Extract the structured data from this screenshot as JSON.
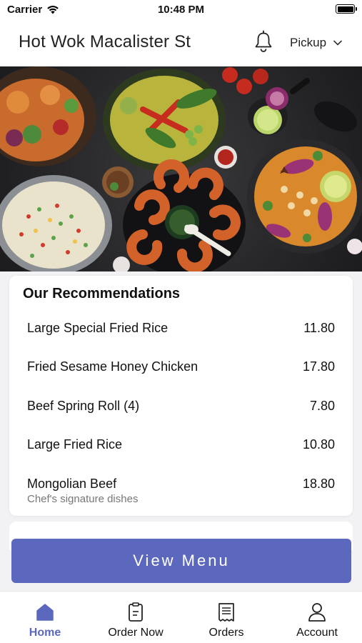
{
  "status_bar": {
    "carrier": "Carrier",
    "time": "10:48 PM"
  },
  "header": {
    "title": "Hot Wok Macalister St",
    "order_mode": "Pickup"
  },
  "recommendations": {
    "title": "Our Recommendations",
    "items": [
      {
        "name": "Large Special Fried Rice",
        "price": "11.80",
        "note": ""
      },
      {
        "name": "Fried Sesame Honey Chicken",
        "price": "17.80",
        "note": ""
      },
      {
        "name": "Beef Spring Roll (4)",
        "price": "7.80",
        "note": ""
      },
      {
        "name": "Large Fried Rice",
        "price": "10.80",
        "note": ""
      },
      {
        "name": "Mongolian Beef",
        "price": "18.80",
        "note": "Chef's signature dishes"
      }
    ]
  },
  "view_menu": {
    "label": "View Menu"
  },
  "tab_bar": {
    "tabs": [
      {
        "label": "Home",
        "icon": "home-icon",
        "active": true
      },
      {
        "label": "Order Now",
        "icon": "order-now-icon",
        "active": false
      },
      {
        "label": "Orders",
        "icon": "receipt-icon",
        "active": false
      },
      {
        "label": "Account",
        "icon": "person-icon",
        "active": false
      }
    ]
  },
  "colors": {
    "accent": "#5b68bd",
    "background": "#f2f2f4"
  }
}
